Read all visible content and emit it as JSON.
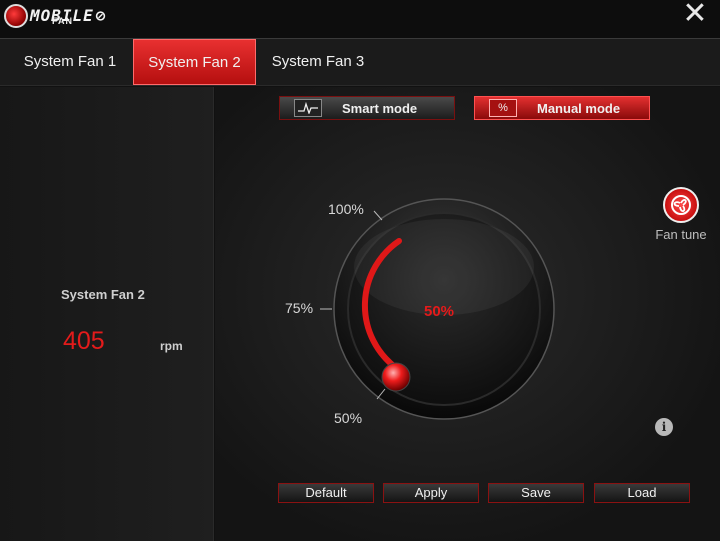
{
  "app": {
    "logo_text": "MOBILE",
    "logo_sub": "FAN",
    "close_glyph": "✕"
  },
  "tabs": [
    {
      "label": "System Fan 1",
      "active": false
    },
    {
      "label": "System Fan 2",
      "active": true
    },
    {
      "label": "System Fan 3",
      "active": false
    }
  ],
  "status": {
    "fan_name": "System Fan 2",
    "rpm": "405",
    "rpm_unit": "rpm"
  },
  "modes": {
    "smart": {
      "label": "Smart mode",
      "icon": "waveform-icon",
      "active": false
    },
    "manual": {
      "label": "Manual mode",
      "icon": "percent-icon",
      "icon_glyph": "%",
      "active": true
    }
  },
  "knob": {
    "value_label": "50%",
    "value_fraction": 0.5,
    "ticks": {
      "top": "100%",
      "mid": "75%",
      "bottom": "50%"
    }
  },
  "fan_tune": {
    "label": "Fan tune",
    "icon": "fan-icon"
  },
  "info_glyph": "i",
  "actions": {
    "default_label": "Default",
    "apply_label": "Apply",
    "save_label": "Save",
    "load_label": "Load"
  },
  "colors": {
    "accent": "#e31b1b",
    "background": "#111111"
  }
}
